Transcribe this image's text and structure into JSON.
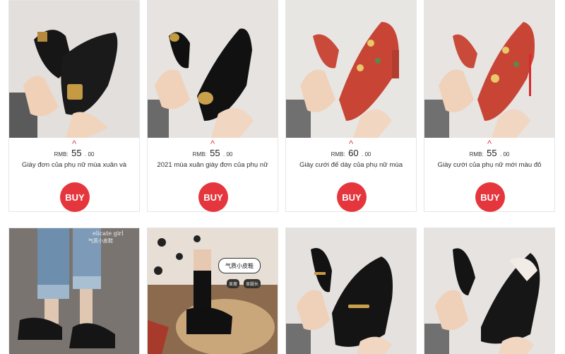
{
  "products": [
    {
      "price_label": "RMB:",
      "price_whole": "55",
      "price_cents": ". 00",
      "name": "Giày đơn của phụ nữ mùa xuân và",
      "buy_label": "BUY",
      "photo_icon": "black-buckle-mary-jane-shoes"
    },
    {
      "price_label": "RMB:",
      "price_whole": "55",
      "price_cents": ". 00",
      "name": "2021 mùa xuân giày đơn của phụ nữ",
      "buy_label": "BUY",
      "photo_icon": "black-gold-buckle-pumps"
    },
    {
      "price_label": "RMB:",
      "price_whole": "60",
      "price_cents": ". 00",
      "name": "Giày cưới đế dày của phụ nữ mùa",
      "buy_label": "BUY",
      "photo_icon": "red-embroidered-block-heels"
    },
    {
      "price_label": "RMB:",
      "price_whole": "55",
      "price_cents": ". 00",
      "name": "Giày cưới của phụ nữ mới màu đỏ",
      "buy_label": "BUY",
      "photo_icon": "red-embroidered-stiletto-heels"
    }
  ],
  "row2": [
    {
      "photo_icon": "black-loafers-jeans",
      "overlay_text": "elicate girl",
      "overlay_sub": "气质小皮鞋"
    },
    {
      "photo_icon": "black-loafers-socks",
      "overlay_text": "气质小皮鞋",
      "tags": [
        "显瘦",
        "显腿长"
      ]
    },
    {
      "photo_icon": "black-horsebit-loafers"
    },
    {
      "photo_icon": "black-pointed-mules"
    }
  ],
  "colors": {
    "accent": "#e5363d",
    "caret": "#e23540"
  }
}
